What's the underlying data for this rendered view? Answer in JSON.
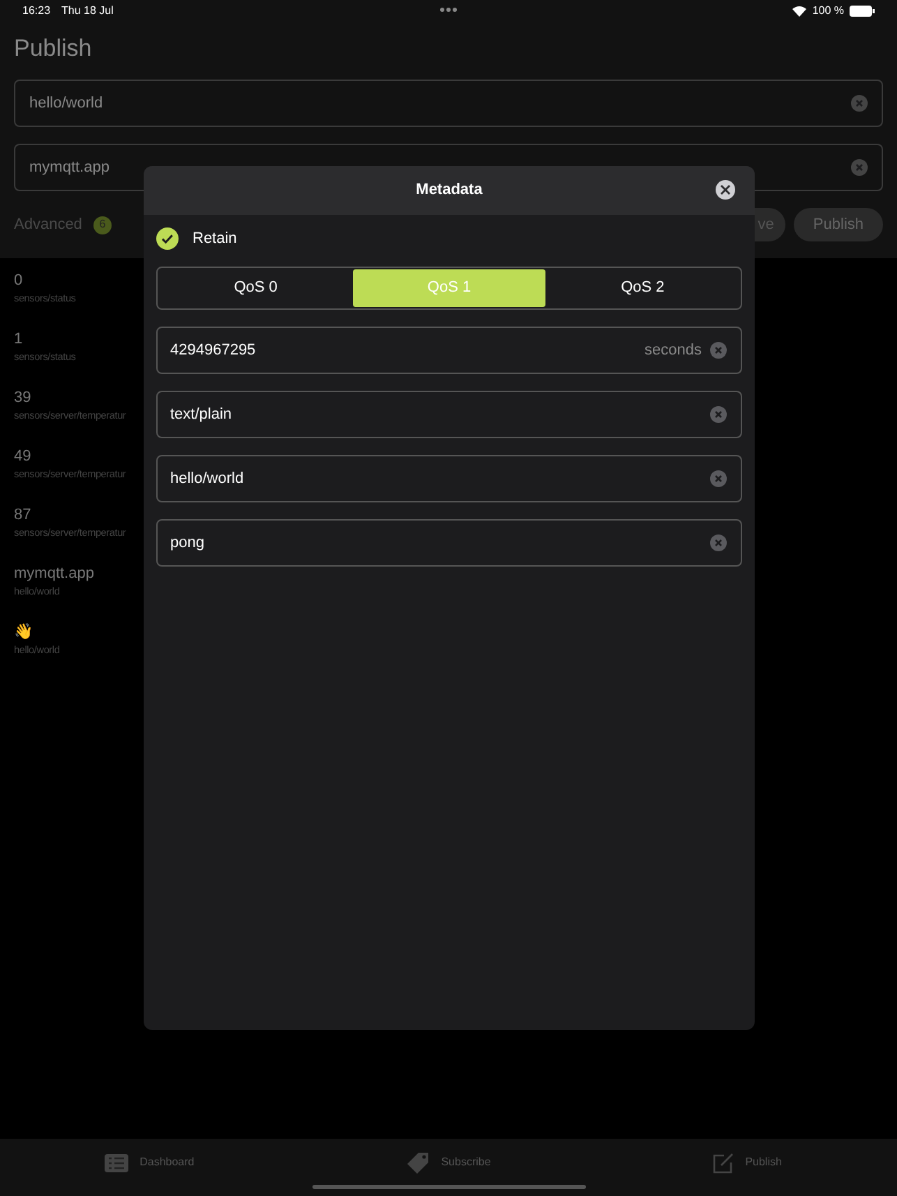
{
  "status_bar": {
    "time": "16:23",
    "date": "Thu 18 Jul",
    "battery": "100 %"
  },
  "title": "Publish",
  "fields": [
    {
      "value": "hello/world"
    },
    {
      "value": "mymqtt.app"
    }
  ],
  "advanced": {
    "label": "Advanced",
    "badge": "6"
  },
  "buttons": [
    {
      "label": "ve"
    },
    {
      "label": "Publish"
    }
  ],
  "messages": [
    {
      "value": "0",
      "topic": "sensors/status"
    },
    {
      "value": "1",
      "topic": "sensors/status"
    },
    {
      "value": "39",
      "topic": "sensors/server/temperatur"
    },
    {
      "value": "49",
      "topic": "sensors/server/temperatur"
    },
    {
      "value": "87",
      "topic": "sensors/server/temperatur"
    },
    {
      "value": "mymqtt.app",
      "topic": "hello/world"
    },
    {
      "value": "👋",
      "topic": "hello/world"
    }
  ],
  "modal": {
    "title": "Metadata",
    "retain": {
      "label": "Retain",
      "checked": true
    },
    "qos": [
      {
        "label": "QoS 0",
        "selected": false
      },
      {
        "label": "QoS 1",
        "selected": true
      },
      {
        "label": "QoS 2",
        "selected": false
      }
    ],
    "fields": [
      {
        "value": "4294967295",
        "suffix": "seconds"
      },
      {
        "value": "text/plain"
      },
      {
        "value": "hello/world"
      },
      {
        "value": "pong"
      }
    ]
  },
  "tab_bar": [
    {
      "label": "Dashboard"
    },
    {
      "label": "Subscribe"
    },
    {
      "label": "Publish"
    }
  ]
}
